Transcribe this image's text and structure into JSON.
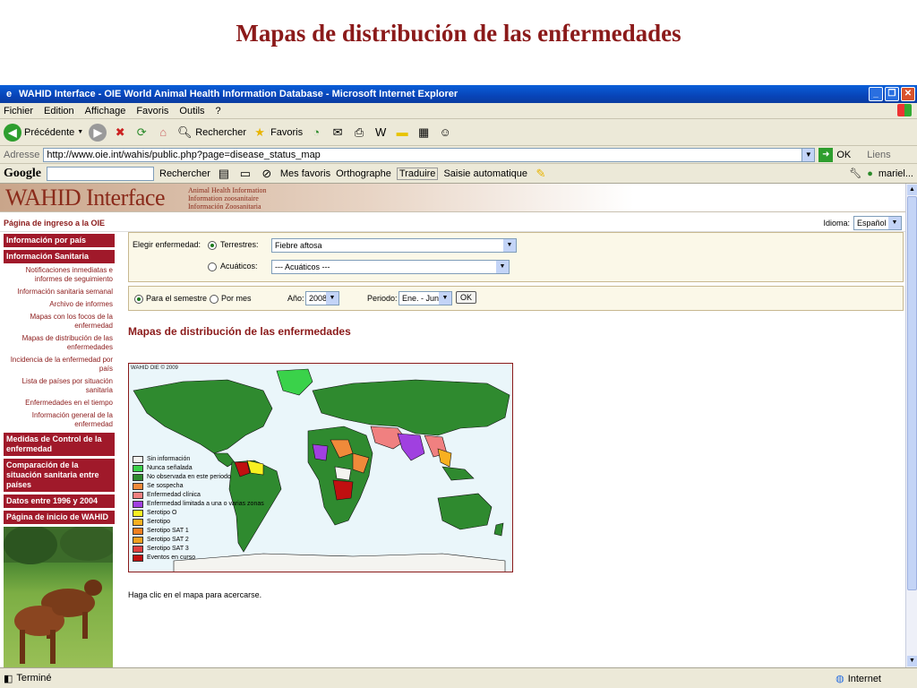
{
  "slide": {
    "title": "Mapas de distribución de las enfermedades"
  },
  "window": {
    "title": "WAHID Interface - OIE World Animal Health Information Database - Microsoft Internet Explorer",
    "menu": [
      "Fichier",
      "Edition",
      "Affichage",
      "Favoris",
      "Outils",
      "?"
    ],
    "toolbar": {
      "back": "Précédente",
      "search": "Rechercher",
      "favorites": "Favoris"
    },
    "address": {
      "label": "Adresse",
      "url": "http://www.oie.int/wahis/public.php?page=disease_status_map",
      "go": "OK",
      "links": "Liens"
    },
    "google": {
      "logo": "Google",
      "search": "Rechercher",
      "favorites": "Mes favoris",
      "spell": "Orthographe",
      "translate": "Traduire",
      "autofill": "Saisie automatique",
      "user": "mariel..."
    },
    "status": {
      "left": "Terminé",
      "zone": "Internet"
    }
  },
  "page": {
    "logo": "WAHID Interface",
    "logo_sub": [
      "Animal Health Information",
      "Information zoosanitaire",
      "Información Zoosanitaria"
    ],
    "home_link": "Página de ingreso a la OIE",
    "language_label": "Idioma:",
    "language_value": "Español",
    "sidebar": {
      "country_info": "Información por país",
      "sanitary_info": "Información Sanitaria",
      "sub_items": [
        "Notificaciones inmediatas e informes de seguimiento",
        "Información sanitaria semanal",
        "Archivo de informes",
        "Mapas con los focos de la enfermedad",
        "Mapas de distribución de las enfermedades",
        "Incidencia de la enfermedad por país",
        "Lista de países por situación sanitaria",
        "Enfermedades en el tiempo",
        "Información general de la enfermedad"
      ],
      "control": "Medidas de Control de la enfermedad",
      "compare": "Comparación de la situación sanitaria entre países",
      "data": "Datos entre 1996 y 2004",
      "wahid_home": "Página de inicio de WAHID"
    },
    "form": {
      "choose_label": "Elegir enfermedad:",
      "terrestrial_label": "Terrestres:",
      "terrestrial_value": "Fiebre aftosa",
      "aquatic_label": "Acuáticos:",
      "aquatic_value": "--- Acuáticos ---",
      "semester_label": "Para el semestre",
      "month_label": "Por mes",
      "year_label": "Año:",
      "year_value": "2008",
      "period_label": "Periodo:",
      "period_value": "Ene. - Jun.",
      "ok": "OK"
    },
    "map_title": "Mapas de distribución de las enfermedades",
    "map_credit": "WAHID OIE © 2009",
    "legend": [
      {
        "label": "Sin información",
        "color": "#f4f4f0"
      },
      {
        "label": "Nunca señalada",
        "color": "#3ad24a"
      },
      {
        "label": "No observada en este periodo",
        "color": "#2f8a2f"
      },
      {
        "label": "Se sospecha",
        "color": "#f08a3a"
      },
      {
        "label": "Enfermedad clínica",
        "color": "#f08080"
      },
      {
        "label": "Enfermedad limitada a una o varias zonas",
        "color": "#a040e0"
      },
      {
        "label": "Serotipo O",
        "color": "#f8f020"
      },
      {
        "label": "Serotipo",
        "color": "#f8b020"
      },
      {
        "label": "Serotipo SAT 1",
        "color": "#f08020"
      },
      {
        "label": "Serotipo SAT 2",
        "color": "#f0a020"
      },
      {
        "label": "Serotipo SAT 3",
        "color": "#e04040"
      },
      {
        "label": "Eventos en curso",
        "color": "#c01010"
      }
    ],
    "hint": "Haga clic en el mapa para acercarse."
  }
}
